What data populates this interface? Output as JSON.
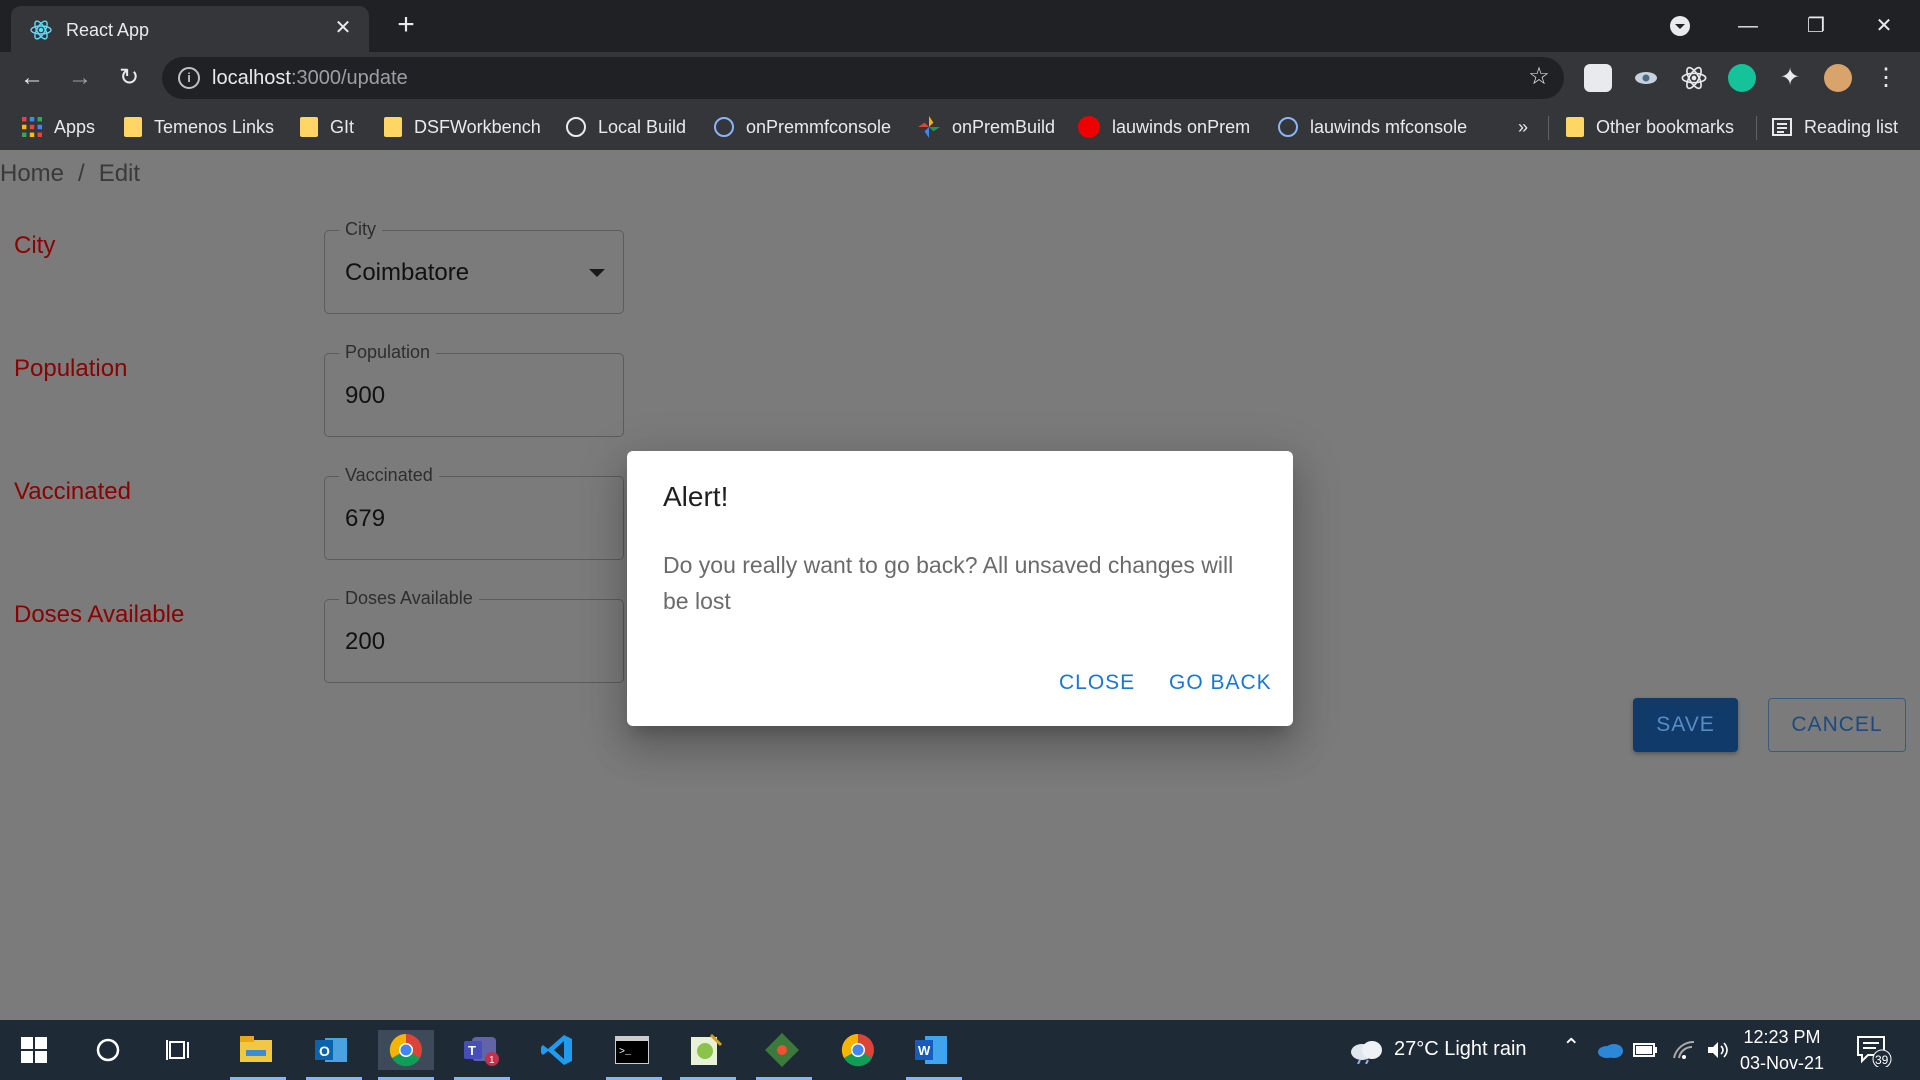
{
  "browser": {
    "tab_title": "React App",
    "url_host": "localhost",
    "url_path": ":3000/update",
    "bookmarks": [
      {
        "label": "Apps",
        "icon": "apps-grid-icon"
      },
      {
        "label": "Temenos Links",
        "icon": "folder-icon"
      },
      {
        "label": "GIt",
        "icon": "folder-icon"
      },
      {
        "label": "DSFWorkbench",
        "icon": "folder-icon"
      },
      {
        "label": "Local Build",
        "icon": "globe-icon"
      },
      {
        "label": "onPremmfconsole",
        "icon": "globe-icon"
      },
      {
        "label": "onPremBuild",
        "icon": "pinwheel-icon"
      },
      {
        "label": "lauwinds onPrem",
        "icon": "redhat-icon"
      },
      {
        "label": "lauwinds mfconsole",
        "icon": "globe-icon"
      }
    ],
    "bookmarks_more": "»",
    "other_bookmarks": "Other bookmarks",
    "reading_list": "Reading list"
  },
  "page": {
    "breadcrumb": {
      "home": "Home",
      "separator": "/",
      "current": "Edit"
    },
    "fields": [
      {
        "label": "City",
        "legend": "City",
        "value": "Coimbatore",
        "type": "select"
      },
      {
        "label": "Population",
        "legend": "Population",
        "value": "900",
        "type": "text"
      },
      {
        "label": "Vaccinated",
        "legend": "Vaccinated",
        "value": "679",
        "type": "text"
      },
      {
        "label": "Doses Available",
        "legend": "Doses Available",
        "value": "200",
        "type": "text"
      }
    ],
    "save_label": "SAVE",
    "cancel_label": "CANCEL"
  },
  "dialog": {
    "title": "Alert!",
    "message": "Do you really want to go back? All unsaved changes will be lost",
    "close_label": "CLOSE",
    "go_back_label": "GO BACK"
  },
  "taskbar": {
    "weather": "27°C  Light rain",
    "time": "12:23 PM",
    "date": "03-Nov-21",
    "notification_count": "39",
    "teams_badge": "1"
  },
  "colors": {
    "accent": "#1976d2",
    "label_red": "#8b0000",
    "save_bg": "#0f3a6a",
    "overlay": "#7b7b7b"
  }
}
